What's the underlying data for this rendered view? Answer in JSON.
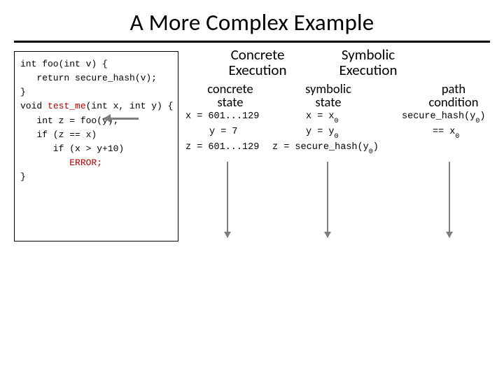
{
  "title": "A More Complex Example",
  "code": {
    "l1": "int foo(int v) {",
    "l2": "   return secure_hash(v);",
    "l3": "}",
    "l4": "",
    "l5a": "void ",
    "l5b": "test_me",
    "l5c": "(int x, int y) {",
    "l6": "   int z = foo(y);",
    "l7": "   if (z == x)",
    "l8": "      if (x > y+10)",
    "l9a": "         ",
    "l9b": "ERROR;",
    "l10": "}"
  },
  "headers": {
    "concrete": "Concrete\nExecution",
    "symbolic": "Symbolic\nExecution",
    "concrete_state": "concrete\nstate",
    "symbolic_state": "symbolic\nstate",
    "path_condition": "path\ncondition"
  },
  "rows": {
    "c1": "x = 601...129",
    "s1a": "x = x",
    "s1b": "0",
    "p1a": "secure_hash(y",
    "p1b": "0",
    "p1c": ")",
    "c2": "y = 7",
    "s2a": "y = y",
    "s2b": "0",
    "p2a": "== x",
    "p2b": "0",
    "c3": "z = 601...129",
    "s3a": "z = secure_hash(y",
    "s3b": "0",
    "s3c": ")"
  }
}
